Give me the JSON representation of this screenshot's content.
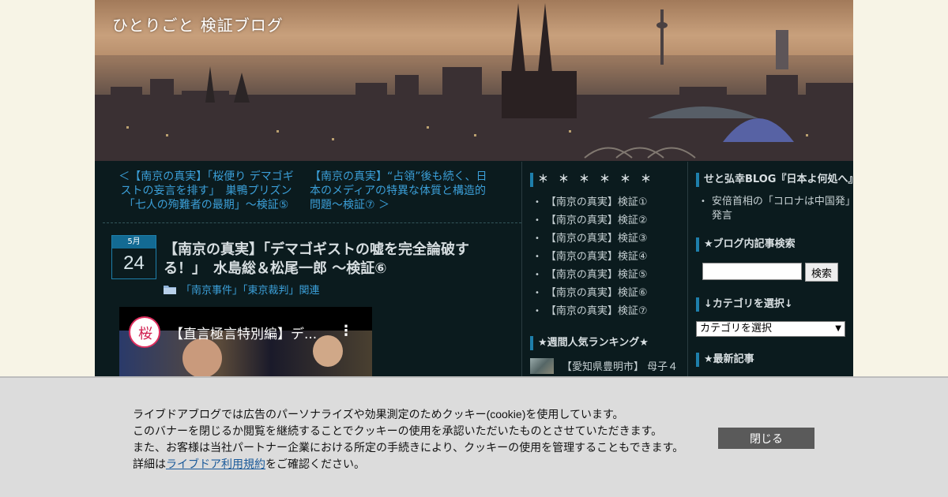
{
  "header": {
    "blog_title": "ひとりごと 検証ブログ"
  },
  "pager": {
    "prev": "＜【南京の真実】「桜便り デマゴギストの妄言を排す」　巣鴨プリズン「七人の殉難者の最期」～検証⑤",
    "next": "【南京の真実】“占領”後も続く、日本のメディアの特異な体質と構造的問題～検証⑦ ＞"
  },
  "article": {
    "month": "5月",
    "day": "24",
    "title": "【南京の真実】「デマゴギストの嘘を完全論破する！」　水島総＆松尾一郎 ～検証⑥",
    "category_prefix": "「南京事件」「東京裁判」関連",
    "video_title": "【直言極言特別編】デ..."
  },
  "sidebar1": {
    "heading": "＊　＊　＊　＊　＊　＊",
    "items": [
      "【南京の真実】検証①",
      "【南京の真実】検証②",
      "【南京の真実】検証③",
      "【南京の真実】検証④",
      "【南京の真実】検証⑤",
      "【南京の真実】検証⑥",
      "【南京の真実】検証⑦"
    ],
    "ranking_heading": "★週間人気ランキング★",
    "ranking_item": "【愛知県豊明市】 母子４"
  },
  "sidebar2": {
    "heading": "せと弘幸BLOG『日本よ何処へ』",
    "items": [
      "安倍首相の「コロナは中国発」発言"
    ],
    "search_heading": "★ブログ内記事検索",
    "search_button": "検索",
    "category_heading": "↓カテゴリを選択↓",
    "category_select": "カテゴリを選択",
    "recent_heading": "★最新記事"
  },
  "cookie": {
    "line1": "ライブドアブログでは広告のパーソナライズや効果測定のためクッキー(cookie)を使用しています。",
    "line2": "このバナーを閉じるか閲覧を継続することでクッキーの使用を承認いただいたものとさせていただきます。",
    "line3": "また、お客様は当社パートナー企業における所定の手続きにより、クッキーの使用を管理することもできます。",
    "line4_pre": "詳細は",
    "line4_link": "ライブドア利用規約",
    "line4_post": "をご確認ください。",
    "close_label": "閉じる"
  },
  "colors": {
    "page_bg": "#f7f4e6",
    "content_bg": "#0b1b1e",
    "link": "#3b9fd8",
    "accent": "#1e7fab"
  }
}
